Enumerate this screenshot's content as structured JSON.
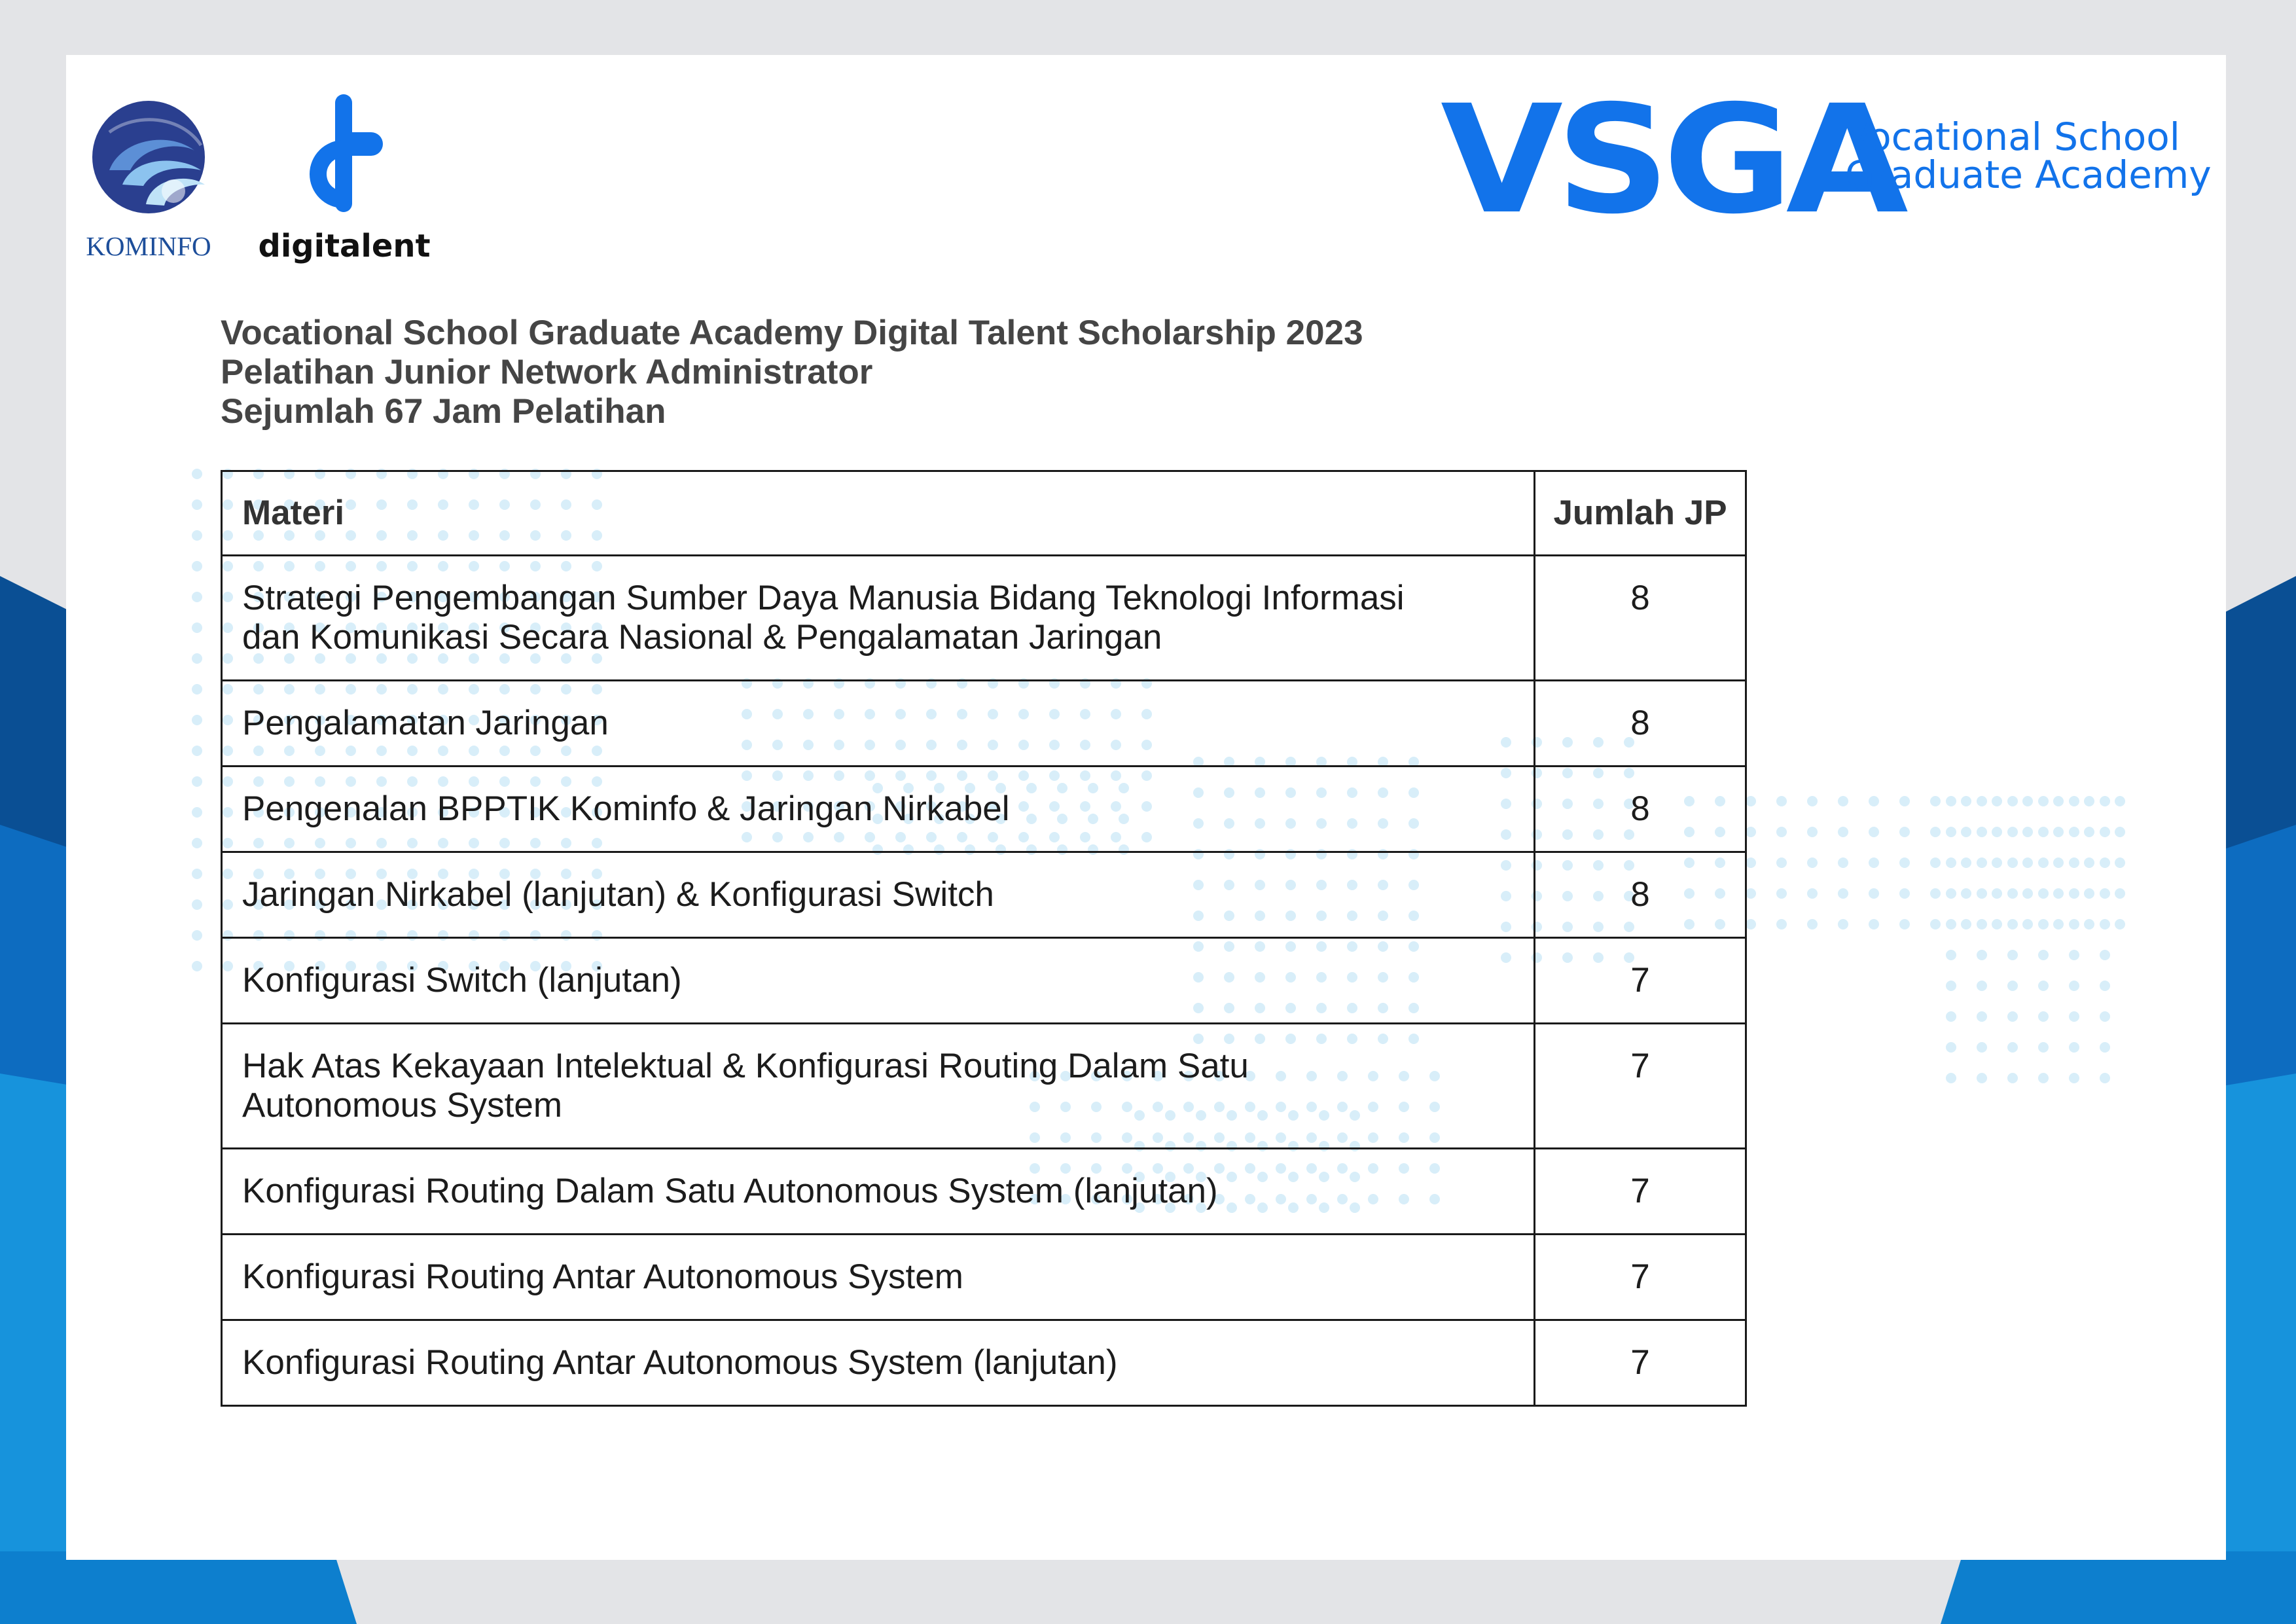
{
  "colors": {
    "brand_blue": "#1273ea",
    "band_dark": "#0a4f94",
    "band_mid": "#0d6cc0",
    "band_light": "#1793dc",
    "dots": "#d8eef9"
  },
  "logos": {
    "kominfo": {
      "label": "KOMINFO",
      "icon": "kominfo-emblem-icon"
    },
    "digitalent": {
      "label": "digitalent",
      "icon": "digitalent-emblem-icon"
    },
    "vsga": {
      "mark": "VSGA",
      "line1": "Vocational School",
      "line2": "Graduate Academy"
    }
  },
  "heading": {
    "line1": "Vocational School Graduate Academy Digital Talent Scholarship 2023",
    "line2": "Pelatihan Junior Network Administrator",
    "line3": "Sejumlah 67 Jam Pelatihan"
  },
  "table": {
    "headers": {
      "materi": "Materi",
      "jp": "Jumlah JP"
    },
    "rows": [
      {
        "line1": "Strategi Pengembangan Sumber Daya Manusia Bidang Teknologi Informasi",
        "line2": "dan Komunikasi Secara Nasional & Pengalamatan Jaringan",
        "jp": "8"
      },
      {
        "line1": "Pengalamatan Jaringan",
        "jp": "8"
      },
      {
        "line1": "Pengenalan BPPTIK Kominfo & Jaringan Nirkabel",
        "jp": "8"
      },
      {
        "line1": "Jaringan Nirkabel (lanjutan) & Konfigurasi Switch",
        "jp": "8"
      },
      {
        "line1": "Konfigurasi Switch (lanjutan)",
        "jp": "7"
      },
      {
        "line1": "Hak Atas Kekayaan Intelektual & Konfigurasi Routing Dalam Satu",
        "line2": "Autonomous System",
        "jp": "7"
      },
      {
        "line1": "Konfigurasi Routing Dalam Satu Autonomous System (lanjutan)",
        "jp": "7"
      },
      {
        "line1": "Konfigurasi Routing Antar Autonomous System",
        "jp": "7"
      },
      {
        "line1": "Konfigurasi Routing Antar Autonomous System (lanjutan)",
        "jp": "7"
      }
    ]
  }
}
